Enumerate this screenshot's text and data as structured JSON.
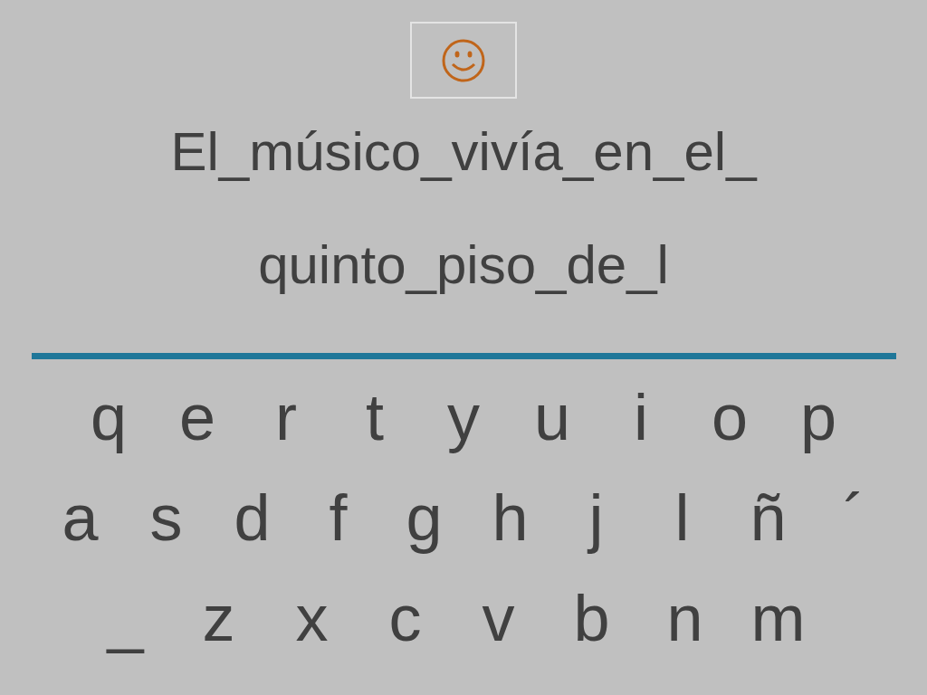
{
  "sentence_lines": [
    "El_músico_vivía_en_el_",
    "quinto_piso_de_l"
  ],
  "keyboard": {
    "rows": [
      [
        "q",
        "e",
        "r",
        "t",
        "y",
        "u",
        "i",
        "o",
        "p"
      ],
      [
        "a",
        "s",
        "d",
        "f",
        "g",
        "h",
        "j",
        "l",
        "ñ",
        "´"
      ],
      [
        "_",
        "z",
        "x",
        "c",
        "v",
        "b",
        "n",
        "m"
      ]
    ]
  }
}
